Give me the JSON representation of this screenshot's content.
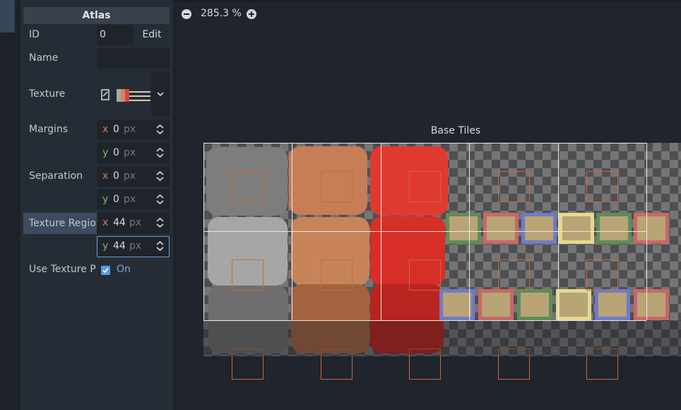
{
  "inspector": {
    "section_title": "Atlas",
    "id": {
      "label": "ID",
      "value": "0",
      "edit_label": "Edit"
    },
    "name": {
      "label": "Name",
      "value": ""
    },
    "texture": {
      "label": "Texture"
    },
    "margins": {
      "label": "Margins",
      "x": "0",
      "y": "0",
      "unit": "px",
      "x_axis": "x",
      "y_axis": "y"
    },
    "separation": {
      "label": "Separation",
      "x": "0",
      "y": "0",
      "unit": "px",
      "x_axis": "x",
      "y_axis": "y"
    },
    "texture_region": {
      "label": "Texture Regio",
      "x": "44",
      "y": "44",
      "unit": "px",
      "x_axis": "x",
      "y_axis": "y"
    },
    "use_texture_padding": {
      "label": "Use Texture P",
      "checked": true,
      "value_label": "On"
    }
  },
  "editor": {
    "zoom_label": "285.3 %",
    "atlas_title": "Base Tiles"
  },
  "colors": {
    "accent": "#5a9ae6",
    "highlight": "#3c4b60",
    "x_axis": "#d57d5a",
    "y_axis": "#7fb863"
  }
}
